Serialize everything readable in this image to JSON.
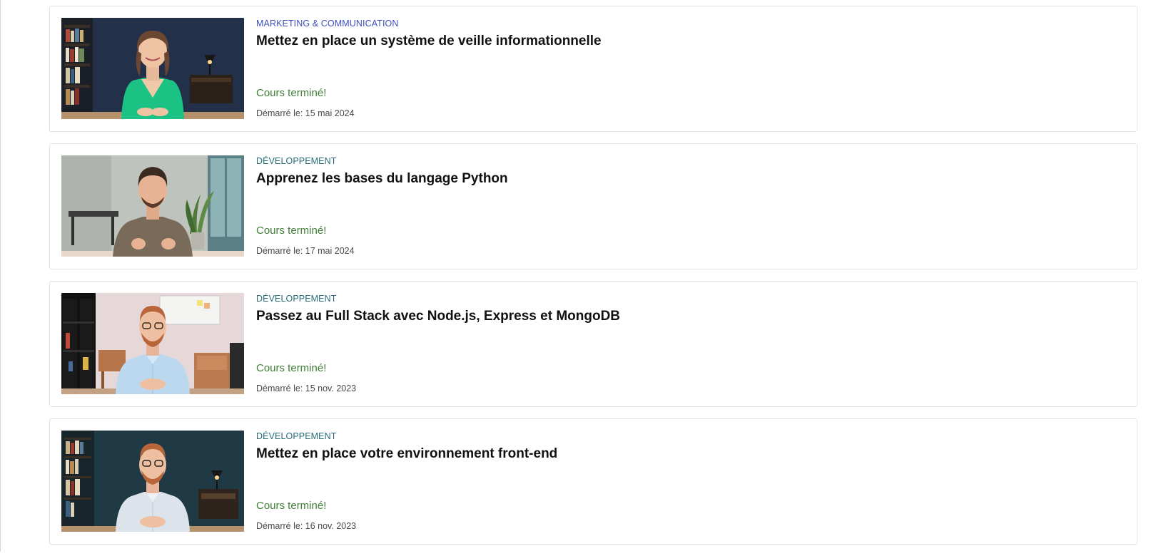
{
  "courses": [
    {
      "category": "Marketing & Communication",
      "category_color": "#3d4fbf",
      "title": "Mettez en place un système de veille informationnelle",
      "status": "Cours terminé!",
      "date_label": "Démarré le: 15 mai 2024",
      "thumbnail": "instructor-woman-green-top"
    },
    {
      "category": "Développement",
      "category_color": "#256b78",
      "title": "Apprenez les bases du langage Python",
      "status": "Cours terminé!",
      "date_label": "Démarré le: 17 mai 2024",
      "thumbnail": "instructor-man-brown-tshirt"
    },
    {
      "category": "Développement",
      "category_color": "#256b78",
      "title": "Passez au Full Stack avec Node.js, Express et MongoDB",
      "status": "Cours terminé!",
      "date_label": "Démarré le: 15 nov. 2023",
      "thumbnail": "instructor-man-blue-shirt"
    },
    {
      "category": "Développement",
      "category_color": "#256b78",
      "title": "Mettez en place votre environnement front-end",
      "status": "Cours terminé!",
      "date_label": "Démarré le: 16 nov. 2023",
      "thumbnail": "instructor-man-white-shirt"
    }
  ]
}
